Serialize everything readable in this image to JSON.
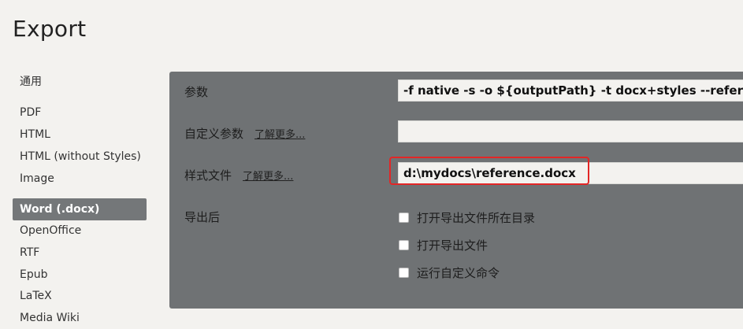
{
  "page": {
    "title": "Export"
  },
  "sidebar": {
    "items": [
      {
        "label": "通用"
      },
      {
        "label": "PDF"
      },
      {
        "label": "HTML"
      },
      {
        "label": "HTML (without Styles)"
      },
      {
        "label": "Image"
      },
      {
        "label": "Word (.docx)",
        "active": true
      },
      {
        "label": "OpenOffice"
      },
      {
        "label": "RTF"
      },
      {
        "label": "Epub"
      },
      {
        "label": "LaTeX"
      },
      {
        "label": "Media Wiki"
      }
    ]
  },
  "settings": {
    "params_label": "参数",
    "params_value": "-f native -s -o ${outputPath} -t docx+styles --reference-doc",
    "custom_params_label": "自定义参数",
    "custom_params_learn_more": "了解更多...",
    "custom_params_value": "",
    "style_file_label": "样式文件",
    "style_file_learn_more": "了解更多...",
    "style_file_value": "d:\\mydocs\\reference.docx",
    "after_export_label": "导出后",
    "after_export_options": [
      {
        "label": "打开导出文件所在目录",
        "checked": false
      },
      {
        "label": "打开导出文件",
        "checked": false
      },
      {
        "label": "运行自定义命令",
        "checked": false
      }
    ]
  },
  "colors": {
    "panel_bg": "#6f7274",
    "active_item_bg": "#747779",
    "highlight_border": "#e32626",
    "page_bg": "#f3f2ef"
  }
}
